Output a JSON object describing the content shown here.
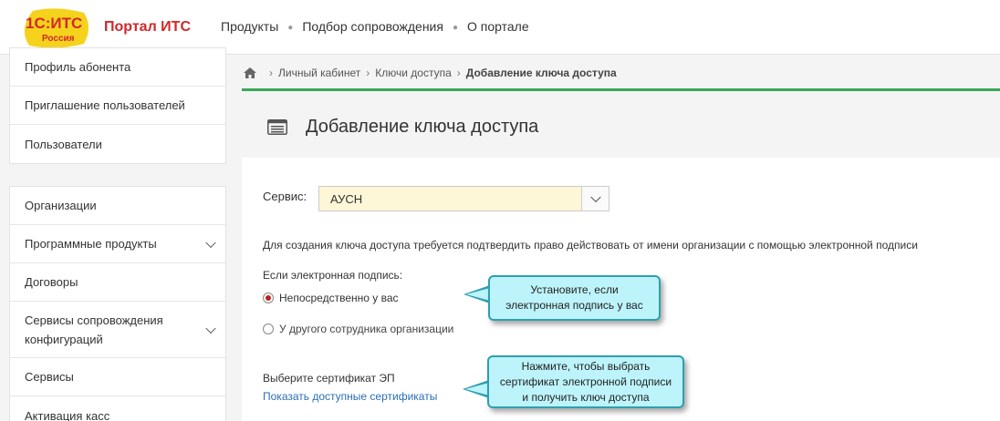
{
  "header": {
    "logo": {
      "top_text": "1С:ИТС",
      "bottom_text": "Россия"
    },
    "portal_title": "Портал ИТС",
    "nav": [
      "Продукты",
      "Подбор сопровождения",
      "О портале"
    ]
  },
  "sidebar": {
    "group1": [
      "Профиль абонента",
      "Приглашение пользователей",
      "Пользователи"
    ],
    "group2": [
      {
        "label": "Организации",
        "has_chevron": false
      },
      {
        "label": "Программные продукты",
        "has_chevron": true
      },
      {
        "label": "Договоры",
        "has_chevron": false
      },
      {
        "label_line1": "Сервисы сопровождения",
        "label_line2": "конфигураций",
        "has_chevron": true
      },
      {
        "label": "Сервисы",
        "has_chevron": false
      },
      {
        "label": "Активация касс",
        "has_chevron": false
      }
    ]
  },
  "breadcrumb": {
    "home_icon": "home-icon",
    "items": [
      "Личный кабинет",
      "Ключи доступа"
    ],
    "current": "Добавление ключа доступа"
  },
  "page": {
    "icon": "list-window-icon",
    "title": "Добавление ключа доступа"
  },
  "form": {
    "service_label": "Сервис:",
    "service_value": "АУСН",
    "info_text": "Для создания ключа доступа требуется подтвердить право действовать от имени организации с помощью электронной подписи",
    "signature_label": "Если электронная подпись:",
    "radio_options": [
      {
        "label": "Непосредственно у вас",
        "checked": true
      },
      {
        "label": "У другого сотрудника организации",
        "checked": false
      }
    ],
    "certificate_label": "Выберите сертификат ЭП",
    "certificate_link": "Показать доступные сертификаты"
  },
  "callouts": [
    {
      "line1": "Установите, если",
      "line2": "электронная подпись у вас"
    },
    {
      "line1": "Нажмите, чтобы выбрать",
      "line2": "сертификат электронной подписи",
      "line3": "и получить ключ доступа"
    }
  ],
  "colors": {
    "brand_red": "#d2282b",
    "logo_yellow": "#f5d21c",
    "breadcrumb_accent": "#3aa757",
    "select_bg": "#fdf6d7",
    "link": "#2a6fb5",
    "callout_bg": "#bdf4fb",
    "callout_border": "#2e9fb0"
  }
}
